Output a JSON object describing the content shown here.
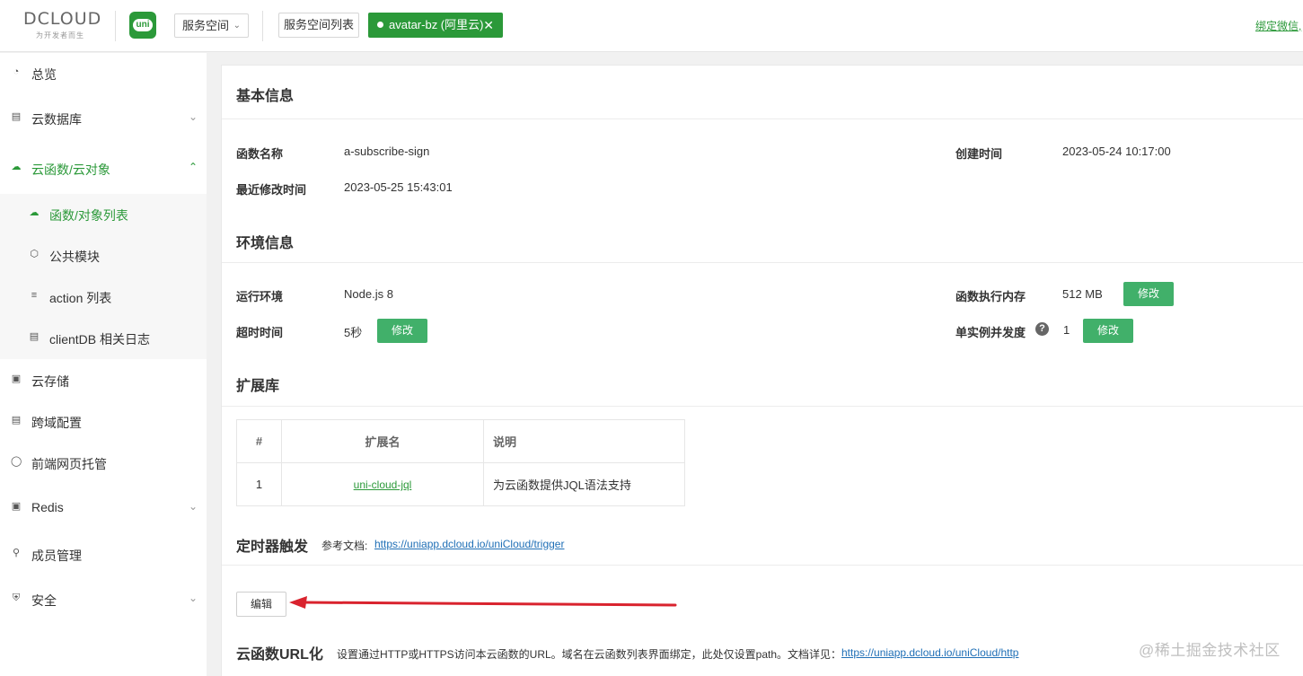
{
  "header": {
    "logo_text": "DCLOUD",
    "logo_slogan": "为开发者而生",
    "uni_logo_text": "uni",
    "space_select_label": "服务空间",
    "space_list_button": "服务空间列表",
    "active_space_tag": "avatar-bz (阿里云)",
    "bind_wechat_link": "绑定微信,"
  },
  "sidebar": {
    "items": [
      {
        "label": "总览",
        "icon": "pie-chart-icon"
      },
      {
        "label": "云数据库",
        "icon": "database-icon",
        "expandable": true
      },
      {
        "label": "云函数/云对象",
        "icon": "cloud-icon",
        "expandable": true,
        "expanded": true
      },
      {
        "label": "云存储",
        "icon": "storage-icon"
      },
      {
        "label": "跨域配置",
        "icon": "cross-domain-icon"
      },
      {
        "label": "前端网页托管",
        "icon": "hosting-icon"
      },
      {
        "label": "Redis",
        "icon": "redis-icon",
        "expandable": true
      },
      {
        "label": "成员管理",
        "icon": "member-icon"
      },
      {
        "label": "安全",
        "icon": "shield-icon",
        "expandable": true
      }
    ],
    "sub_items": [
      {
        "label": "函数/对象列表",
        "icon": "cloud-icon",
        "active": true
      },
      {
        "label": "公共模块",
        "icon": "cube-icon"
      },
      {
        "label": "action 列表",
        "icon": "list-icon"
      },
      {
        "label": "clientDB 相关日志",
        "icon": "log-icon"
      }
    ]
  },
  "basic_info": {
    "title": "基本信息",
    "function_name_label": "函数名称",
    "function_name": "a-subscribe-sign",
    "created_label": "创建时间",
    "created": "2023-05-24 10:17:00",
    "modified_label": "最近修改时间",
    "modified": "2023-05-25 15:43:01"
  },
  "env_info": {
    "title": "环境信息",
    "runtime_label": "运行环境",
    "runtime": "Node.js 8",
    "memory_label": "函数执行内存",
    "memory": "512 MB",
    "timeout_label": "超时时间",
    "timeout": "5秒",
    "concurrency_label": "单实例并发度",
    "concurrency": "1",
    "modify_button": "修改"
  },
  "extensions": {
    "title": "扩展库",
    "columns": [
      "#",
      "扩展名",
      "说明"
    ],
    "rows": [
      {
        "num": "1",
        "name": "uni-cloud-jql",
        "desc": "为云函数提供JQL语法支持"
      }
    ]
  },
  "timer": {
    "title": "定时器触发",
    "doc_label": "参考文档:",
    "doc_link": "https://uniapp.dcloud.io/uniCloud/trigger",
    "edit_button": "编辑"
  },
  "url_section": {
    "title": "云函数URL化",
    "description": "设置通过HTTP或HTTPS访问本云函数的URL。域名在云函数列表界面绑定，此处仅设置path。文档详见：",
    "doc_link": "https://uniapp.dcloud.io/uniCloud/http"
  },
  "watermark": "@稀土掘金技术社区",
  "colors": {
    "brand_green": "#2b9939",
    "button_green": "#41b06a",
    "link_blue": "#1f6fb6",
    "arrow_red": "#d9232e"
  }
}
